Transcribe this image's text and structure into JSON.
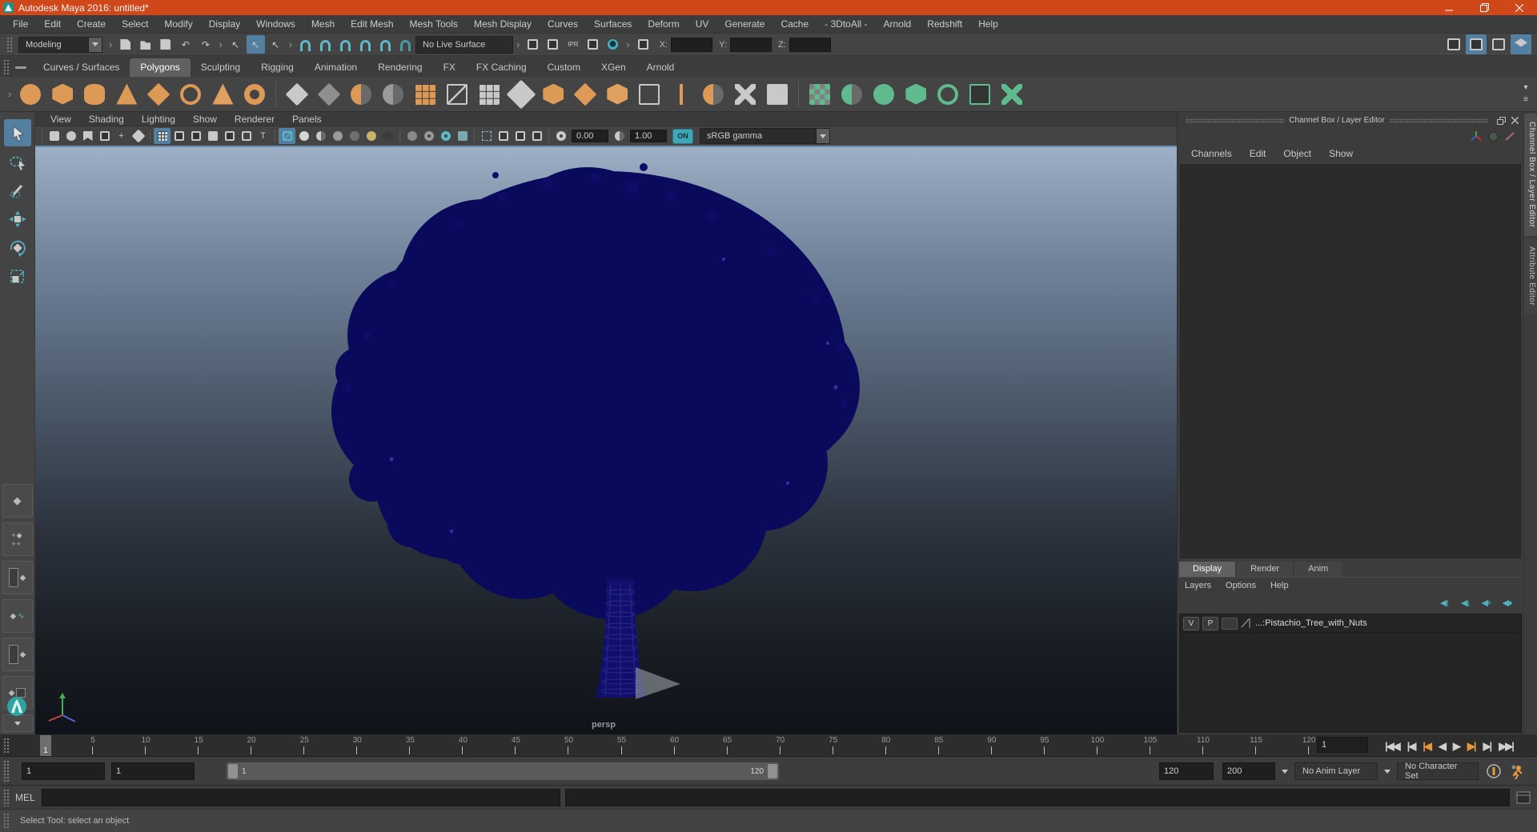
{
  "colors": {
    "title_bar": "#d0481a",
    "accent_blue": "#537fa0",
    "teal": "#5fb8c8",
    "shelf_orange": "#dd9a57",
    "shelf_green": "#5fba8e",
    "tree_navy": "#0a0a5c",
    "viewport_top": "#9db0c5",
    "viewport_bottom": "#10141a"
  },
  "window": {
    "title": "Autodesk Maya 2016: untitled*"
  },
  "menu_bar": {
    "items": [
      "File",
      "Edit",
      "Create",
      "Select",
      "Modify",
      "Display",
      "Windows",
      "Mesh",
      "Edit Mesh",
      "Mesh Tools",
      "Mesh Display",
      "Curves",
      "Surfaces",
      "Deform",
      "UV",
      "Generate",
      "Cache",
      "- 3DtoAll -",
      "Arnold",
      "Redshift",
      "Help"
    ]
  },
  "status_line": {
    "menuset": "Modeling",
    "live_surface": "No Live Surface",
    "x_label": "X:",
    "y_label": "Y:",
    "z_label": "Z:"
  },
  "shelf": {
    "tabs": [
      "Curves / Surfaces",
      "Polygons",
      "Sculpting",
      "Rigging",
      "Animation",
      "Rendering",
      "FX",
      "FX Caching",
      "Custom",
      "XGen",
      "Arnold"
    ],
    "active_tab": "Polygons"
  },
  "panel_menu": {
    "items": [
      "View",
      "Shading",
      "Lighting",
      "Show",
      "Renderer",
      "Panels"
    ]
  },
  "viewport_bar": {
    "exposure": "0.00",
    "gamma": "1.00",
    "on_label": "ON",
    "colorspace": "sRGB gamma"
  },
  "viewport": {
    "camera_label": "persp"
  },
  "channel_box": {
    "title": "Channel Box / Layer Editor",
    "menus": [
      "Channels",
      "Edit",
      "Object",
      "Show"
    ],
    "vertical_tabs": [
      "Channel Box / Layer Editor",
      "Attribute Editor"
    ]
  },
  "layer_editor": {
    "tabs": [
      "Display",
      "Render",
      "Anim"
    ],
    "active_tab": "Display",
    "menus": [
      "Layers",
      "Options",
      "Help"
    ],
    "layers": [
      {
        "visible": "V",
        "playback": "P",
        "name": "...:Pistachio_Tree_with_Nuts"
      }
    ]
  },
  "timeline": {
    "ticks": [
      5,
      10,
      15,
      20,
      25,
      30,
      35,
      40,
      45,
      50,
      55,
      60,
      65,
      70,
      75,
      80,
      85,
      90,
      95,
      100,
      105,
      110,
      115,
      120
    ],
    "current_frame": "1"
  },
  "playback": {
    "current_time": "1"
  },
  "range_slider": {
    "anim_start": "1",
    "playback_start": "1",
    "bar_start_label": "1",
    "bar_end_label": "120",
    "playback_end": "120",
    "anim_end": "200",
    "anim_layer": "No Anim Layer",
    "character_set": "No Character Set"
  },
  "command_line": {
    "label": "MEL"
  },
  "help_line": {
    "text": "Select Tool: select an object"
  },
  "icons": {
    "file_ops": [
      {
        "n": "new-scene",
        "s": "doc"
      },
      {
        "n": "open-scene",
        "s": "folder"
      },
      {
        "n": "save-scene",
        "s": "floppy"
      },
      {
        "n": "undo",
        "g": "↶"
      },
      {
        "n": "redo",
        "g": "↷"
      }
    ],
    "selection_masks": [
      {
        "n": "select-hierarchy",
        "g": "↖"
      },
      {
        "n": "select-object",
        "g": "↖",
        "a": true
      },
      {
        "n": "select-component",
        "g": "↖"
      }
    ],
    "snapping": [
      {
        "n": "snap-to-grid",
        "s": "arc",
        "c": "#5fb8c8"
      },
      {
        "n": "snap-to-curve",
        "s": "arc",
        "c": "#5fb8c8"
      },
      {
        "n": "snap-to-point",
        "s": "arc",
        "c": "#5fb8c8"
      },
      {
        "n": "snap-to-projected-center",
        "s": "arc",
        "c": "#5fb8c8"
      },
      {
        "n": "snap-to-view-plane",
        "s": "arc",
        "c": "#5fb8c8"
      },
      {
        "n": "make-live",
        "s": "arc",
        "c": "#4a99a8"
      }
    ],
    "rendering": [
      {
        "n": "open-render-view",
        "s": "window"
      },
      {
        "n": "render-current-frame",
        "s": "window"
      },
      {
        "n": "ipr-render",
        "g": "IPR",
        "f": 8
      },
      {
        "n": "render-settings",
        "s": "window"
      },
      {
        "n": "render-view-orb",
        "s": "orb",
        "c": "#3fb0c0"
      }
    ],
    "symmetry": [
      {
        "n": "symmetry-settings",
        "s": "window"
      }
    ],
    "sidebar_toggles": [
      {
        "n": "modeling-toolkit-toggle",
        "s": "window"
      },
      {
        "n": "channel-box-toggle",
        "s": "window",
        "a": true
      },
      {
        "n": "tool-settings-toggle",
        "s": "outline"
      },
      {
        "n": "attribute-editor-toggle",
        "s": "layers",
        "a": true
      }
    ],
    "shelf_polygons": [
      {
        "n": "poly-sphere",
        "s": "circle",
        "c": "#dd9a57"
      },
      {
        "n": "poly-cube",
        "s": "cube",
        "c": "#dd9a57"
      },
      {
        "n": "poly-cylinder",
        "s": "cylinder",
        "c": "#dd9a57"
      },
      {
        "n": "poly-cone",
        "s": "cone",
        "c": "#dd9a57"
      },
      {
        "n": "poly-plane",
        "s": "diamond",
        "c": "#dd9a57"
      },
      {
        "n": "poly-torus",
        "s": "ring",
        "c": "#dd9a57"
      },
      {
        "n": "poly-pyramid",
        "s": "cone",
        "c": "#e0a060"
      },
      {
        "n": "poly-pipe",
        "s": "ringthick",
        "c": "#dd9a57"
      },
      {
        "s": "sep"
      },
      {
        "n": "combine",
        "s": "diamond",
        "c": "#c9c9c9"
      },
      {
        "n": "separate",
        "s": "diamond",
        "c": "#8f8f8f"
      },
      {
        "n": "boolean-union",
        "s": "half",
        "c": "#dd9a57"
      },
      {
        "n": "boolean-difference",
        "s": "half",
        "c": "#9a9a9a"
      },
      {
        "n": "smooth",
        "s": "grid",
        "c": "#dd9a57"
      },
      {
        "n": "subdivide",
        "s": "cubewire",
        "c": "#c9c9c9"
      },
      {
        "n": "reduce",
        "s": "grid",
        "c": "#c9c9c9"
      },
      {
        "n": "quad-draw",
        "s": "pencil",
        "c": "#c9c9c9"
      },
      {
        "n": "extrude",
        "s": "cube",
        "c": "#dd9a57"
      },
      {
        "n": "bridge",
        "s": "diamond",
        "c": "#dd9a57"
      },
      {
        "n": "bevel",
        "s": "cube",
        "c": "#e0a060"
      },
      {
        "n": "edit-edge-flow",
        "s": "outline",
        "c": "#c9c9c9"
      },
      {
        "n": "insert-edge-loop",
        "s": "vbar",
        "c": "#dd9a57"
      },
      {
        "n": "offset-edge-loop",
        "s": "half",
        "c": "#dd9a57"
      },
      {
        "n": "multi-cut",
        "s": "x",
        "c": "#c9c9c9"
      },
      {
        "n": "target-weld",
        "s": "square",
        "c": "#c9c9c9"
      },
      {
        "s": "sep"
      },
      {
        "n": "planar-mapping",
        "s": "checker",
        "c": "#5fba8e"
      },
      {
        "n": "cylindrical-mapping",
        "s": "half",
        "c": "#5fba8e"
      },
      {
        "n": "spherical-mapping",
        "s": "circle",
        "c": "#5fba8e"
      },
      {
        "n": "automatic-mapping",
        "s": "cube",
        "c": "#5fba8e"
      },
      {
        "n": "unfold",
        "s": "ring",
        "c": "#5fba8e"
      },
      {
        "n": "uv-editor",
        "s": "window",
        "c": "#5fba8e"
      },
      {
        "n": "cut-sew-uv",
        "s": "x",
        "c": "#5fba8e"
      }
    ],
    "shelf_right": [
      {
        "n": "shelf-overflow",
        "g": "▾"
      },
      {
        "n": "shelf-menu",
        "g": "≡"
      }
    ],
    "vp_camera": [
      {
        "n": "select-camera",
        "s": "square"
      },
      {
        "n": "camera-attributes",
        "s": "circle"
      },
      {
        "n": "camera-bookmarks",
        "s": "flag"
      },
      {
        "n": "image-plane",
        "s": "window"
      },
      {
        "n": "pan-zoom",
        "g": "+"
      },
      {
        "n": "grease-pencil",
        "s": "pencil"
      }
    ],
    "vp_gates": [
      {
        "n": "grid-toggle",
        "s": "grid",
        "c": "#cfd8dc",
        "a": true
      },
      {
        "n": "film-gate",
        "s": "window"
      },
      {
        "n": "resolution-gate",
        "s": "window"
      },
      {
        "n": "gate-mask",
        "s": "square"
      },
      {
        "n": "field-chart",
        "s": "window"
      },
      {
        "n": "safe-action",
        "s": "outline"
      },
      {
        "n": "safe-title",
        "g": "T"
      }
    ],
    "vp_shading": [
      {
        "n": "wireframe-display",
        "s": "cubewire",
        "c": "#5fb8c8",
        "a": true
      },
      {
        "n": "smooth-shade",
        "s": "circle",
        "c": "#d6d6d6"
      },
      {
        "n": "textured-display",
        "s": "half",
        "c": "#c9c9c9"
      },
      {
        "n": "use-default-material",
        "s": "circle",
        "c": "#9a9a9a"
      },
      {
        "n": "xray-display",
        "s": "circle",
        "c": "#707070"
      },
      {
        "n": "lighting-toggle",
        "s": "circle",
        "c": "#c9b46a"
      },
      {
        "n": "shadows-toggle",
        "s": "circle",
        "c": "#3c3c3c"
      }
    ],
    "vp_effects": [
      {
        "n": "screen-space-ao",
        "s": "circle",
        "c": "#8a8a8a"
      },
      {
        "n": "motion-blur",
        "s": "ring",
        "c": "#9a9a9a"
      },
      {
        "n": "anti-aliasing",
        "s": "ring",
        "c": "#5fb8c8"
      },
      {
        "n": "depth-of-field",
        "s": "square",
        "c": "#7aa8b0"
      }
    ],
    "vp_panels": [
      {
        "n": "isolate-select",
        "s": "dashed",
        "c": "#9ab8c8"
      },
      {
        "n": "pane-layout-single",
        "s": "window"
      },
      {
        "n": "pane-layout-split",
        "s": "window"
      },
      {
        "n": "viewport-snapshot",
        "s": "window"
      }
    ],
    "vp_exposure": [
      {
        "n": "exposure",
        "s": "ring",
        "c": "#c9c9c9"
      }
    ],
    "vp_gamma": [
      {
        "n": "gamma-contrast",
        "s": "half",
        "c": "#c9c9c9"
      }
    ],
    "layer_ops": [
      {
        "n": "move-layer-up",
        "g": "◀↑",
        "c": "#4fb0c0"
      },
      {
        "n": "move-layer-down",
        "g": "◀↓",
        "c": "#4fb0c0"
      },
      {
        "n": "add-empty-layer",
        "g": "◀+",
        "c": "#4fb0c0"
      },
      {
        "n": "add-layer-from-selected",
        "g": "◀●",
        "c": "#4fb0c0"
      }
    ],
    "playback": [
      {
        "n": "go-to-start",
        "g": "|◀◀"
      },
      {
        "n": "step-back-frame",
        "g": "|◀"
      },
      {
        "n": "step-back-key",
        "g": "|◀",
        "accent": true
      },
      {
        "n": "play-backwards",
        "g": "◀"
      },
      {
        "n": "play-forwards",
        "g": "▶"
      },
      {
        "n": "step-forward-key",
        "g": "▶|",
        "accent": true
      },
      {
        "n": "step-forward-frame",
        "g": "▶|"
      },
      {
        "n": "go-to-end",
        "g": "▶▶|"
      }
    ]
  }
}
